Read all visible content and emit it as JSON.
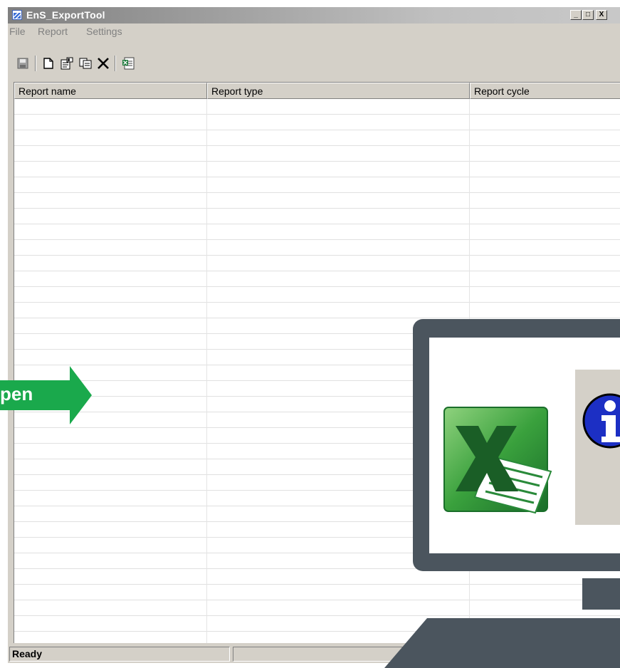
{
  "window": {
    "title": "EnS_ExportTool",
    "controls": {
      "minimize": "_",
      "maximize": "□",
      "close": "X"
    }
  },
  "menu": {
    "items": [
      "File",
      "Report",
      "Settings"
    ]
  },
  "toolbar": {
    "icons": [
      "save-icon",
      "new-report-icon",
      "edit-report-icon",
      "copy-report-icon",
      "delete-report-icon",
      "export-excel-icon"
    ]
  },
  "table": {
    "columns": [
      "Report name",
      "Report type",
      "Report cycle"
    ],
    "rows": []
  },
  "status": {
    "text": "Ready"
  },
  "overlay": {
    "arrow_label": "pen",
    "arrow_color": "#1aa94c",
    "monitor_color": "#4b555e"
  }
}
